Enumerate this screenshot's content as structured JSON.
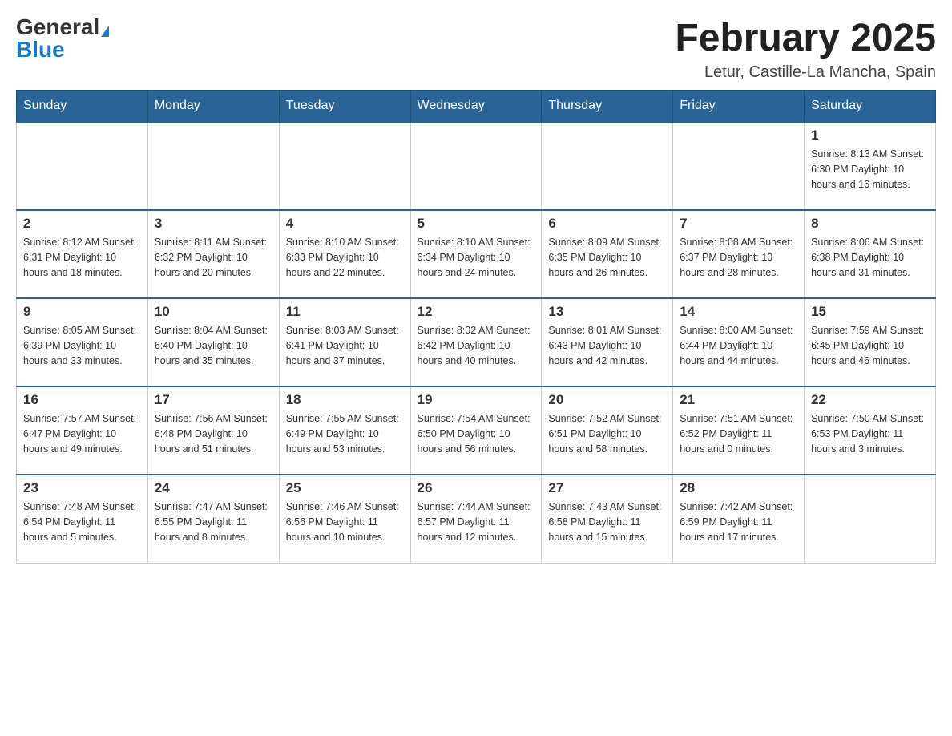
{
  "header": {
    "logo": {
      "general": "General",
      "blue": "Blue",
      "triangle": "▶"
    },
    "title": "February 2025",
    "location": "Letur, Castille-La Mancha, Spain"
  },
  "calendar": {
    "days_of_week": [
      "Sunday",
      "Monday",
      "Tuesday",
      "Wednesday",
      "Thursday",
      "Friday",
      "Saturday"
    ],
    "weeks": [
      {
        "days": [
          {
            "number": "",
            "info": ""
          },
          {
            "number": "",
            "info": ""
          },
          {
            "number": "",
            "info": ""
          },
          {
            "number": "",
            "info": ""
          },
          {
            "number": "",
            "info": ""
          },
          {
            "number": "",
            "info": ""
          },
          {
            "number": "1",
            "info": "Sunrise: 8:13 AM\nSunset: 6:30 PM\nDaylight: 10 hours\nand 16 minutes."
          }
        ]
      },
      {
        "days": [
          {
            "number": "2",
            "info": "Sunrise: 8:12 AM\nSunset: 6:31 PM\nDaylight: 10 hours\nand 18 minutes."
          },
          {
            "number": "3",
            "info": "Sunrise: 8:11 AM\nSunset: 6:32 PM\nDaylight: 10 hours\nand 20 minutes."
          },
          {
            "number": "4",
            "info": "Sunrise: 8:10 AM\nSunset: 6:33 PM\nDaylight: 10 hours\nand 22 minutes."
          },
          {
            "number": "5",
            "info": "Sunrise: 8:10 AM\nSunset: 6:34 PM\nDaylight: 10 hours\nand 24 minutes."
          },
          {
            "number": "6",
            "info": "Sunrise: 8:09 AM\nSunset: 6:35 PM\nDaylight: 10 hours\nand 26 minutes."
          },
          {
            "number": "7",
            "info": "Sunrise: 8:08 AM\nSunset: 6:37 PM\nDaylight: 10 hours\nand 28 minutes."
          },
          {
            "number": "8",
            "info": "Sunrise: 8:06 AM\nSunset: 6:38 PM\nDaylight: 10 hours\nand 31 minutes."
          }
        ]
      },
      {
        "days": [
          {
            "number": "9",
            "info": "Sunrise: 8:05 AM\nSunset: 6:39 PM\nDaylight: 10 hours\nand 33 minutes."
          },
          {
            "number": "10",
            "info": "Sunrise: 8:04 AM\nSunset: 6:40 PM\nDaylight: 10 hours\nand 35 minutes."
          },
          {
            "number": "11",
            "info": "Sunrise: 8:03 AM\nSunset: 6:41 PM\nDaylight: 10 hours\nand 37 minutes."
          },
          {
            "number": "12",
            "info": "Sunrise: 8:02 AM\nSunset: 6:42 PM\nDaylight: 10 hours\nand 40 minutes."
          },
          {
            "number": "13",
            "info": "Sunrise: 8:01 AM\nSunset: 6:43 PM\nDaylight: 10 hours\nand 42 minutes."
          },
          {
            "number": "14",
            "info": "Sunrise: 8:00 AM\nSunset: 6:44 PM\nDaylight: 10 hours\nand 44 minutes."
          },
          {
            "number": "15",
            "info": "Sunrise: 7:59 AM\nSunset: 6:45 PM\nDaylight: 10 hours\nand 46 minutes."
          }
        ]
      },
      {
        "days": [
          {
            "number": "16",
            "info": "Sunrise: 7:57 AM\nSunset: 6:47 PM\nDaylight: 10 hours\nand 49 minutes."
          },
          {
            "number": "17",
            "info": "Sunrise: 7:56 AM\nSunset: 6:48 PM\nDaylight: 10 hours\nand 51 minutes."
          },
          {
            "number": "18",
            "info": "Sunrise: 7:55 AM\nSunset: 6:49 PM\nDaylight: 10 hours\nand 53 minutes."
          },
          {
            "number": "19",
            "info": "Sunrise: 7:54 AM\nSunset: 6:50 PM\nDaylight: 10 hours\nand 56 minutes."
          },
          {
            "number": "20",
            "info": "Sunrise: 7:52 AM\nSunset: 6:51 PM\nDaylight: 10 hours\nand 58 minutes."
          },
          {
            "number": "21",
            "info": "Sunrise: 7:51 AM\nSunset: 6:52 PM\nDaylight: 11 hours\nand 0 minutes."
          },
          {
            "number": "22",
            "info": "Sunrise: 7:50 AM\nSunset: 6:53 PM\nDaylight: 11 hours\nand 3 minutes."
          }
        ]
      },
      {
        "days": [
          {
            "number": "23",
            "info": "Sunrise: 7:48 AM\nSunset: 6:54 PM\nDaylight: 11 hours\nand 5 minutes."
          },
          {
            "number": "24",
            "info": "Sunrise: 7:47 AM\nSunset: 6:55 PM\nDaylight: 11 hours\nand 8 minutes."
          },
          {
            "number": "25",
            "info": "Sunrise: 7:46 AM\nSunset: 6:56 PM\nDaylight: 11 hours\nand 10 minutes."
          },
          {
            "number": "26",
            "info": "Sunrise: 7:44 AM\nSunset: 6:57 PM\nDaylight: 11 hours\nand 12 minutes."
          },
          {
            "number": "27",
            "info": "Sunrise: 7:43 AM\nSunset: 6:58 PM\nDaylight: 11 hours\nand 15 minutes."
          },
          {
            "number": "28",
            "info": "Sunrise: 7:42 AM\nSunset: 6:59 PM\nDaylight: 11 hours\nand 17 minutes."
          },
          {
            "number": "",
            "info": ""
          }
        ]
      }
    ]
  }
}
